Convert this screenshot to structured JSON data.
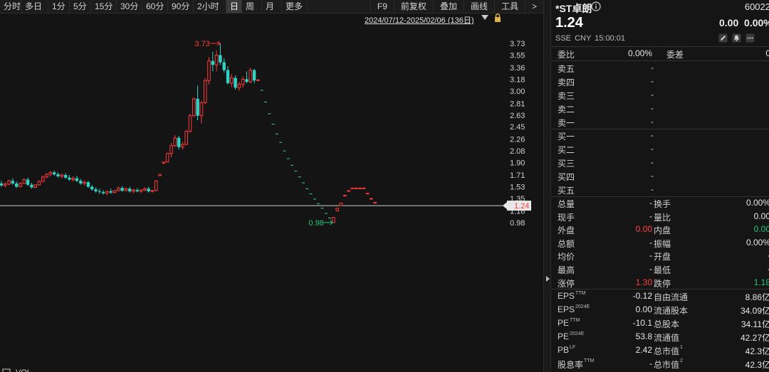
{
  "toolbar": {
    "periods": [
      "分时",
      "多日",
      "1分",
      "5分",
      "15分",
      "30分",
      "60分",
      "90分",
      "2小时",
      "日",
      "周",
      "月",
      "更多"
    ],
    "active": "日",
    "right": [
      "F9",
      "前复权",
      "叠加",
      "画线",
      "工具",
      ">"
    ]
  },
  "chart": {
    "range_label": "2024/07/12-2025/02/06 (136日)",
    "y_ticks": [
      "3.73",
      "3.55",
      "3.36",
      "3.18",
      "3.00",
      "2.81",
      "2.63",
      "2.45",
      "2.26",
      "2.08",
      "1.90",
      "1.71",
      "1.53",
      "1.35",
      "1.16",
      "0.98"
    ],
    "high_label": "3.73",
    "low_label": "0.98",
    "current_tag": "1.24",
    "bottom_label": "VOL",
    "colors": {
      "up": "#ff3b3b",
      "down": "#2fd4c4",
      "dot": "#3fcf9f",
      "bg": "#141414"
    }
  },
  "chart_data": {
    "type": "candlestick",
    "ylim": [
      0.9,
      3.85
    ],
    "candles": [
      [
        1.58,
        1.62,
        1.53,
        1.55
      ],
      [
        1.55,
        1.6,
        1.52,
        1.57
      ],
      [
        1.57,
        1.64,
        1.55,
        1.62
      ],
      [
        1.62,
        1.66,
        1.56,
        1.58
      ],
      [
        1.58,
        1.61,
        1.51,
        1.53
      ],
      [
        1.53,
        1.6,
        1.52,
        1.58
      ],
      [
        1.58,
        1.66,
        1.57,
        1.64
      ],
      [
        1.64,
        1.67,
        1.54,
        1.56
      ],
      [
        1.56,
        1.59,
        1.5,
        1.52
      ],
      [
        1.52,
        1.57,
        1.51,
        1.56
      ],
      [
        1.56,
        1.63,
        1.55,
        1.61
      ],
      [
        1.61,
        1.7,
        1.6,
        1.68
      ],
      [
        1.68,
        1.74,
        1.66,
        1.72
      ],
      [
        1.72,
        1.77,
        1.69,
        1.75
      ],
      [
        1.75,
        1.78,
        1.7,
        1.72
      ],
      [
        1.72,
        1.75,
        1.67,
        1.69
      ],
      [
        1.69,
        1.73,
        1.66,
        1.71
      ],
      [
        1.71,
        1.74,
        1.65,
        1.67
      ],
      [
        1.67,
        1.71,
        1.62,
        1.64
      ],
      [
        1.64,
        1.69,
        1.61,
        1.66
      ],
      [
        1.66,
        1.7,
        1.6,
        1.62
      ],
      [
        1.62,
        1.65,
        1.56,
        1.58
      ],
      [
        1.58,
        1.63,
        1.55,
        1.6
      ],
      [
        1.6,
        1.62,
        1.51,
        1.53
      ],
      [
        1.53,
        1.56,
        1.47,
        1.49
      ],
      [
        1.49,
        1.52,
        1.44,
        1.46
      ],
      [
        1.46,
        1.5,
        1.42,
        1.45
      ],
      [
        1.45,
        1.48,
        1.41,
        1.43
      ],
      [
        1.43,
        1.47,
        1.4,
        1.46
      ],
      [
        1.46,
        1.5,
        1.42,
        1.44
      ],
      [
        1.44,
        1.48,
        1.43,
        1.47
      ],
      [
        1.47,
        1.53,
        1.46,
        1.51
      ],
      [
        1.51,
        1.54,
        1.45,
        1.47
      ],
      [
        1.47,
        1.52,
        1.46,
        1.5
      ],
      [
        1.5,
        1.53,
        1.44,
        1.46
      ],
      [
        1.46,
        1.5,
        1.43,
        1.48
      ],
      [
        1.48,
        1.51,
        1.44,
        1.46
      ],
      [
        1.46,
        1.49,
        1.43,
        1.48
      ],
      [
        1.48,
        1.52,
        1.46,
        1.5
      ],
      [
        1.5,
        1.53,
        1.44,
        1.46
      ],
      [
        1.46,
        1.48,
        1.44,
        1.47
      ],
      [
        1.47,
        1.63,
        1.46,
        1.62
      ],
      [
        1.7,
        1.72,
        1.7,
        1.72
      ],
      [
        1.89,
        1.91,
        1.88,
        1.91
      ],
      [
        1.91,
        2.05,
        1.9,
        2.04
      ],
      [
        2.04,
        2.2,
        1.98,
        2.16
      ],
      [
        2.16,
        2.32,
        2.14,
        2.28
      ],
      [
        2.28,
        2.31,
        2.1,
        2.14
      ],
      [
        2.14,
        2.22,
        2.1,
        2.18
      ],
      [
        2.18,
        2.4,
        2.17,
        2.38
      ],
      [
        2.38,
        2.65,
        2.36,
        2.62
      ],
      [
        2.62,
        2.9,
        2.6,
        2.88
      ],
      [
        2.88,
        3.08,
        2.55,
        2.62
      ],
      [
        2.62,
        2.85,
        2.5,
        2.82
      ],
      [
        2.82,
        3.2,
        2.8,
        3.16
      ],
      [
        3.16,
        3.52,
        3.1,
        3.46
      ],
      [
        3.46,
        3.6,
        3.3,
        3.4
      ],
      [
        3.4,
        3.62,
        3.3,
        3.55
      ],
      [
        3.55,
        3.73,
        3.4,
        3.44
      ],
      [
        3.44,
        3.5,
        3.28,
        3.32
      ],
      [
        3.32,
        3.38,
        3.1,
        3.12
      ],
      [
        3.12,
        3.26,
        3.06,
        3.2
      ],
      [
        3.2,
        3.24,
        3.02,
        3.05
      ],
      [
        3.05,
        3.14,
        3.0,
        3.1
      ],
      [
        3.1,
        3.22,
        3.05,
        3.18
      ],
      [
        3.18,
        3.3,
        3.12,
        3.14
      ],
      [
        3.14,
        3.36,
        3.12,
        3.32
      ],
      [
        3.32,
        3.34,
        3.12,
        3.16
      ],
      [
        3.16,
        3.18,
        3.15,
        3.17
      ]
    ],
    "limit_down_closes": [
      3.01,
      2.83,
      2.65,
      2.49,
      2.34,
      2.21,
      2.08,
      1.96,
      1.86,
      1.77,
      1.68,
      1.59,
      1.5,
      1.42,
      1.34,
      1.27,
      1.2,
      1.12,
      1.05
    ],
    "tail_candles": [
      [
        0.98,
        1.06,
        0.98,
        1.06
      ],
      [
        1.16,
        1.2,
        1.15,
        1.2
      ],
      [
        1.24,
        1.28,
        1.24,
        1.28
      ],
      [
        1.4,
        1.4,
        1.4,
        1.4
      ],
      [
        1.47,
        1.47,
        1.47,
        1.47
      ],
      [
        1.51,
        1.51,
        1.51,
        1.51
      ],
      [
        1.51,
        1.51,
        1.51,
        1.51
      ],
      [
        1.51,
        1.51,
        1.51,
        1.51
      ],
      [
        1.51,
        1.51,
        1.51,
        1.51
      ],
      [
        1.43,
        1.43,
        1.43,
        1.43
      ],
      [
        1.35,
        1.35,
        1.35,
        1.35
      ],
      [
        1.29,
        1.29,
        1.29,
        1.29
      ]
    ],
    "current_price": 1.24,
    "high": 3.73,
    "low": 0.98
  },
  "quote": {
    "name": "*ST卓朗",
    "code": "60022",
    "price": "1.24",
    "change": "0.00",
    "change_pct": "0.00%",
    "meta": "SSE CNY 15:00:01"
  },
  "orderbook": {
    "weibi_label": "委比",
    "weibi_value": "0.00%",
    "weicha_label": "委差",
    "weicha_value": "0",
    "asks": [
      {
        "label": "卖五",
        "value": "-"
      },
      {
        "label": "卖四",
        "value": "-"
      },
      {
        "label": "卖三",
        "value": "-"
      },
      {
        "label": "卖二",
        "value": "-"
      },
      {
        "label": "卖一",
        "value": "-"
      }
    ],
    "bids": [
      {
        "label": "买一",
        "value": "-"
      },
      {
        "label": "买二",
        "value": "-"
      },
      {
        "label": "买三",
        "value": "-"
      },
      {
        "label": "买四",
        "value": "-"
      },
      {
        "label": "买五",
        "value": "-"
      }
    ]
  },
  "stats": [
    {
      "l1": "总量",
      "v1": "-",
      "c1": "white",
      "l2": "换手",
      "v2": "0.00%",
      "c2": "white"
    },
    {
      "l1": "现手",
      "v1": "-",
      "c1": "white",
      "l2": "量比",
      "v2": "0.00",
      "c2": "white"
    },
    {
      "l1": "外盘",
      "v1": "0.00",
      "c1": "red",
      "l2": "内盘",
      "v2": "0.00",
      "c2": "green"
    },
    {
      "l1": "总额",
      "v1": "-",
      "c1": "white",
      "l2": "振幅",
      "v2": "0.00%",
      "c2": "white"
    },
    {
      "l1": "均价",
      "v1": "-",
      "c1": "white",
      "l2": "开盘",
      "v2": "-",
      "c2": "white"
    },
    {
      "l1": "最高",
      "v1": "-",
      "c1": "white",
      "l2": "最低",
      "v2": "-",
      "c2": "white"
    },
    {
      "l1": "涨停",
      "v1": "1.30",
      "c1": "red",
      "l2": "跌停",
      "v2": "1.18",
      "c2": "green"
    }
  ],
  "fundamentals": [
    {
      "l1": "EPS",
      "s1": "TTM",
      "v1": "-0.12",
      "l2": "自由流通",
      "s2": "",
      "v2": "8.86亿"
    },
    {
      "l1": "EPS",
      "s1": "2024E",
      "v1": "0.00",
      "l2": "流通股本",
      "s2": "",
      "v2": "34.09亿"
    },
    {
      "l1": "PE",
      "s1": "TTM",
      "v1": "-10.1",
      "l2": "总股本",
      "s2": "",
      "v2": "34.11亿"
    },
    {
      "l1": "PE",
      "s1": "2024E",
      "v1": "53.8",
      "l2": "流通值",
      "s2": "",
      "v2": "42.27亿"
    },
    {
      "l1": "PB",
      "s1": "LF",
      "v1": "2.42",
      "l2": "总市值",
      "s2": "1",
      "v2": "42.3亿"
    },
    {
      "l1": "股息率",
      "s1": "TTM",
      "v1": "-",
      "l2": "总市值",
      "s2": "2",
      "v2": "42.3亿"
    }
  ]
}
